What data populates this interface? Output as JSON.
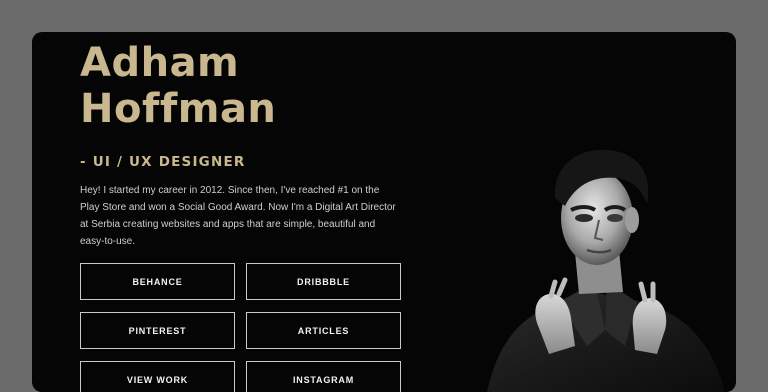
{
  "profile": {
    "name_line1": "Adham",
    "name_line2": "Hoffman",
    "role": "- UI / UX DESIGNER",
    "bio": "Hey! I started my career in 2012. Since then, I've reached #1 on the Play Store and won a Social Good Award. Now I'm a Digital Art Director at Serbia creating websites and apps that are simple, beautiful and easy-to-use."
  },
  "links": [
    {
      "label": "BEHANCE"
    },
    {
      "label": "DRIBBBLE"
    },
    {
      "label": "PINTEREST"
    },
    {
      "label": "ARTICLES"
    },
    {
      "label": "VIEW WORK"
    },
    {
      "label": "INSTAGRAM"
    }
  ],
  "colors": {
    "page_background": "#6b6b6b",
    "card_background": "#050505",
    "accent_gold": "#c9b88f",
    "button_border": "#c9c9c9"
  }
}
